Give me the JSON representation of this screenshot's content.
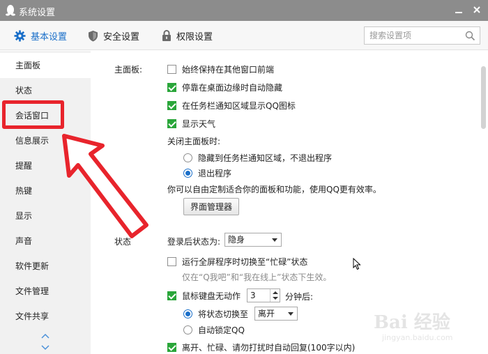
{
  "window": {
    "title": "系统设置"
  },
  "tabs": [
    {
      "label": "基本设置",
      "icon": "gear-icon",
      "active": true
    },
    {
      "label": "安全设置",
      "icon": "shield-icon",
      "active": false
    },
    {
      "label": "权限设置",
      "icon": "lock-icon",
      "active": false
    }
  ],
  "search": {
    "placeholder": "搜索设置项"
  },
  "sidebar": {
    "items": [
      {
        "label": "主面板",
        "active": true
      },
      {
        "label": "状态"
      },
      {
        "label": "会话窗口"
      },
      {
        "label": "信息展示"
      },
      {
        "label": "提醒"
      },
      {
        "label": "热键"
      },
      {
        "label": "显示"
      },
      {
        "label": "声音"
      },
      {
        "label": "软件更新"
      },
      {
        "label": "文件管理"
      },
      {
        "label": "文件共享"
      }
    ]
  },
  "main_panel": {
    "section_label": "主面板:",
    "options": [
      {
        "label": "始终保持在其他窗口前端",
        "checked": false
      },
      {
        "label": "停靠在桌面边缘时自动隐藏",
        "checked": true
      },
      {
        "label": "在任务栏通知区域显示QQ图标",
        "checked": true
      },
      {
        "label": "显示天气",
        "checked": true
      }
    ],
    "close_label": "关闭主面板时:",
    "close_options": [
      {
        "label": "隐藏到任务栏通知区域，不退出程序",
        "selected": false
      },
      {
        "label": "退出程序",
        "selected": true
      }
    ],
    "customize_hint": "你可以自由定制适合你的面板和功能，使用QQ更有效率。",
    "manager_button": "界面管理器"
  },
  "status": {
    "section_label": "状态",
    "after_login_label": "登录后状态为:",
    "after_login_value": "隐身",
    "fullscreen_option": {
      "label": "运行全屏程序时切换至“忙碌”状态",
      "checked": false
    },
    "fullscreen_hint": "仅在“Q我吧”和“我在线上”状态下生效。",
    "idle": {
      "label": "鼠标键盘无动作",
      "checked": true,
      "minutes": "3",
      "suffix": "分钟后:"
    },
    "idle_options": [
      {
        "label": "将状态切换至",
        "selected": true,
        "value": "离开"
      },
      {
        "label": "自动锁定QQ",
        "selected": false
      }
    ],
    "auto_reply": {
      "label": "离开、忙碌、请勿打扰时自动回复(100字以内)",
      "checked": true
    }
  },
  "watermark": {
    "main": "Bai 经验",
    "sub": "jingyan.baidu.com"
  }
}
